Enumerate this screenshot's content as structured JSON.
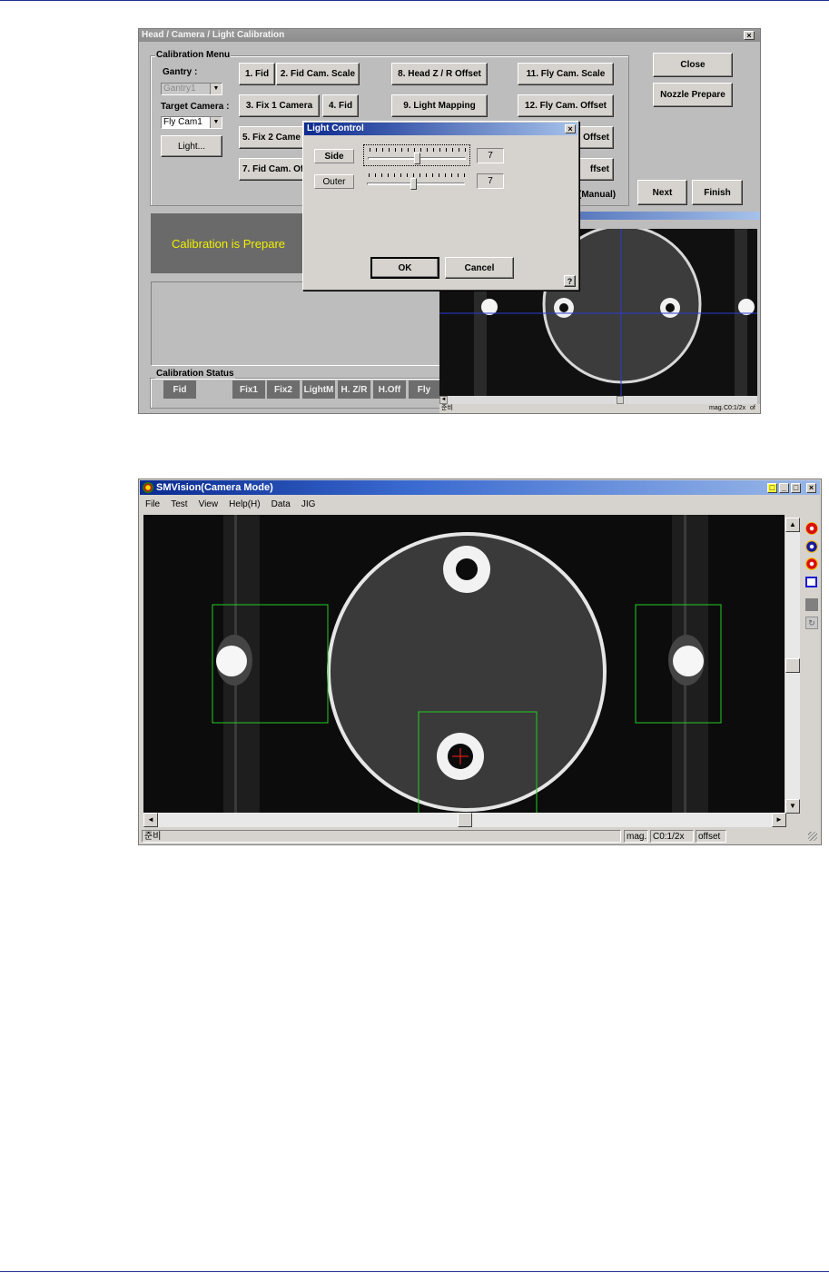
{
  "calibration_window": {
    "title": "Head / Camera / Light Calibration",
    "calibration_menu": {
      "group_label": "Calibration Menu",
      "gantry_label": "Gantry :",
      "gantry_value": "Gantry1",
      "target_camera_label": "Target Camera :",
      "target_camera_value": "Fly Cam1",
      "light_button": "Light...",
      "buttons": {
        "b1": "1. Fid",
        "b2": "2. Fid Cam. Scale",
        "b3": "3. Fix 1 Camera",
        "b4": "4. Fid",
        "b5": "5. Fix 2 Came",
        "b7": "7. Fid Cam. Of",
        "b8": "8. Head Z / R Offset",
        "b9": "9. Light Mapping",
        "b11": "11. Fly Cam. Scale",
        "b12": "12. Fly Cam. Offset",
        "b13_partial": "Offset",
        "b14_partial": "ffset"
      },
      "manual_label": "(Manual)"
    },
    "close_button": "Close",
    "nozzle_prepare_button": "Nozzle Prepare",
    "next_button": "Next",
    "finish_button": "Finish",
    "message": "Calibration is Prepare",
    "status": {
      "group_label": "Calibration Status",
      "items": [
        "Fid",
        "Fix1",
        "Fix2",
        "LightM",
        "H. Z/R",
        "H.Off",
        "Fly"
      ]
    },
    "camera_statusbar": {
      "left": "준비",
      "mag": "mag.",
      "zoom": "C0:1/2x",
      "extra": "of"
    }
  },
  "light_control_dialog": {
    "title": "Light Control",
    "rows": [
      {
        "label": "Side",
        "value": "7",
        "level_fraction": 0.5
      },
      {
        "label": "Outer",
        "value": "7",
        "level_fraction": 0.5
      }
    ],
    "ok_button": "OK",
    "cancel_button": "Cancel",
    "help_button": "?"
  },
  "smvision_window": {
    "title": "SMVision(Camera Mode)",
    "menu": [
      "File",
      "Test",
      "View",
      "Help(H)",
      "Data",
      "JIG"
    ],
    "status": {
      "left": "준비",
      "mag": "mag.",
      "zoom": "C0:1/2x",
      "offset": "offset"
    },
    "tool_icons": [
      "zoom-in-icon",
      "zoom-out-icon",
      "zoom-fit-icon",
      "window-icon",
      "gray-square-icon",
      "refresh-icon"
    ],
    "colors": {
      "roi_box": "#22cc22",
      "crosshair": "#ff2020",
      "titlebar": "#0a2a8e"
    }
  },
  "colors": {
    "window_bg": "#bdbdbd",
    "message_bg": "#6a6a6a",
    "message_text": "#f0f000",
    "status_item_bg": "#6d6d6d",
    "guide_line": "#1f2f8f"
  }
}
